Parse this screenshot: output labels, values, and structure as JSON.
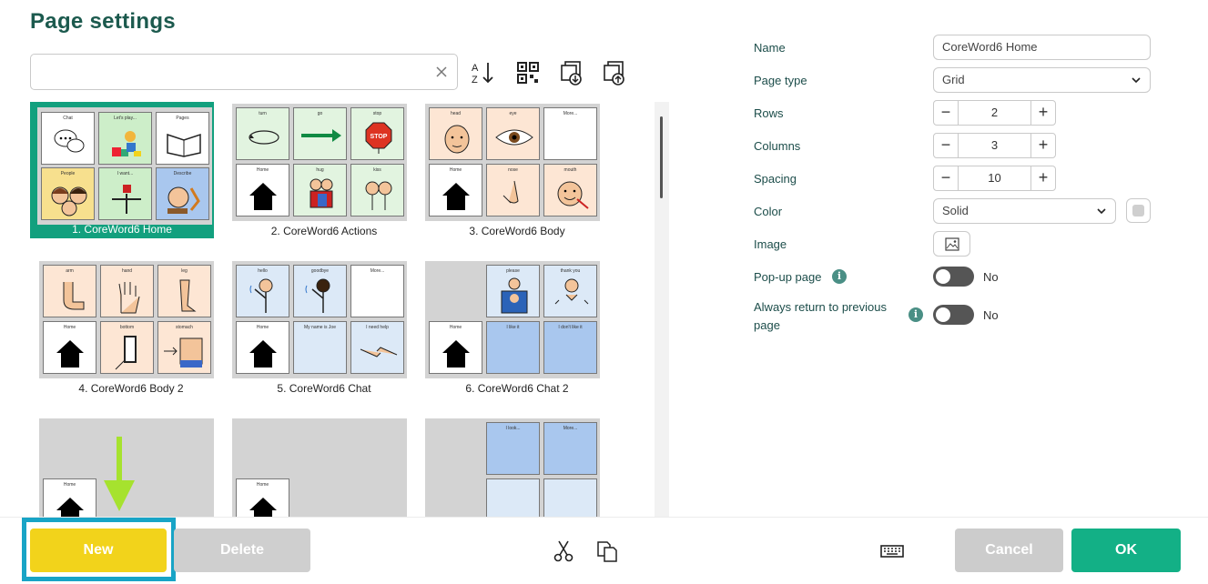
{
  "header": {
    "title": "Page settings"
  },
  "search": {
    "value": "",
    "placeholder": ""
  },
  "toolbar": {
    "icons": [
      "sort-az-icon",
      "qr-code-icon",
      "import-page-icon",
      "export-page-icon"
    ]
  },
  "pages": [
    {
      "label": "1. CoreWord6 Home",
      "cells": [
        "Chat",
        "Let's play...",
        "Pages",
        "People",
        "I want...",
        "Describe"
      ]
    },
    {
      "label": "2. CoreWord6 Actions",
      "cells": [
        "turn",
        "go",
        "stop",
        "Home",
        "hug",
        "kiss"
      ]
    },
    {
      "label": "3. CoreWord6 Body",
      "cells": [
        "head",
        "eye",
        "More...",
        "Home",
        "nose",
        "mouth"
      ]
    },
    {
      "label": "4. CoreWord6 Body 2",
      "cells": [
        "arm",
        "hand",
        "leg",
        "Home",
        "bottom",
        "stomach"
      ]
    },
    {
      "label": "5. CoreWord6 Chat",
      "cells": [
        "hello",
        "goodbye",
        "More...",
        "Home",
        "My name is Joe",
        "I need help"
      ]
    },
    {
      "label": "6. CoreWord6 Chat 2",
      "cells": [
        "please",
        "thank you",
        "Home",
        "I like it",
        "I don't like it"
      ]
    },
    {
      "label": "",
      "cells": [
        "Home"
      ]
    },
    {
      "label": "",
      "cells": [
        "Home"
      ]
    },
    {
      "label": "",
      "cells": [
        "I look...",
        "More..."
      ]
    }
  ],
  "settings": {
    "name_label": "Name",
    "name_value": "CoreWord6 Home",
    "page_type_label": "Page type",
    "page_type_value": "Grid",
    "rows_label": "Rows",
    "rows_value": "2",
    "columns_label": "Columns",
    "columns_value": "3",
    "spacing_label": "Spacing",
    "spacing_value": "10",
    "color_label": "Color",
    "color_value": "Solid",
    "image_label": "Image",
    "popup_label": "Pop-up page",
    "popup_value": "No",
    "return_label": "Always return to previous page",
    "return_value": "No"
  },
  "footer": {
    "new_label": "New",
    "delete_label": "Delete",
    "cancel_label": "Cancel",
    "ok_label": "OK"
  },
  "colors": {
    "accent": "#12a07e",
    "new_button": "#f2d31b",
    "highlight": "#18a4c6",
    "arrow": "#a6e22e",
    "ok_button": "#13b086"
  }
}
